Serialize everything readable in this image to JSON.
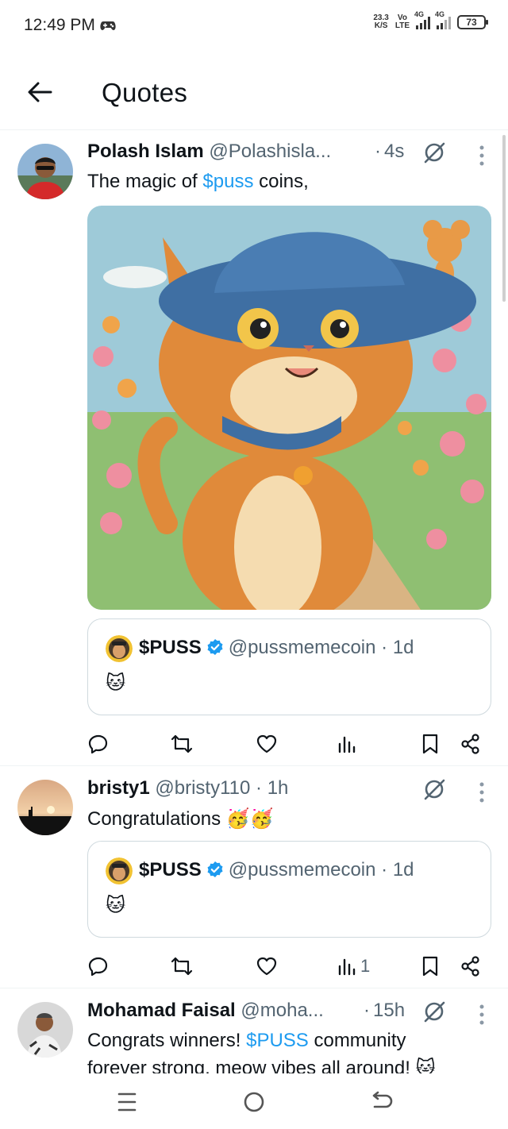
{
  "status_bar": {
    "time": "12:49 PM",
    "net_speed_value": "23.3",
    "net_speed_unit": "K/S",
    "volte_top": "Vo",
    "volte_bottom": "LTE",
    "sim1_label": "4G",
    "sim2_label": "4G",
    "battery": "73"
  },
  "header": {
    "title": "Quotes"
  },
  "posts": [
    {
      "name": "Polash Islam",
      "handle": "@Polashisla...",
      "time": "4s",
      "text_before": "The magic of ",
      "text_link": "$puss",
      "text_after": " coins,",
      "quote": {
        "name": "$PUSS",
        "handle": "@pussmemecoin",
        "time": "1d",
        "text": "🐱"
      },
      "actions": {
        "views": ""
      }
    },
    {
      "name": "bristy1",
      "handle": "@bristy110",
      "time": "1h",
      "text": "Congratulations 🥳🥳",
      "quote": {
        "name": "$PUSS",
        "handle": "@pussmemecoin",
        "time": "1d",
        "text": "🐱"
      },
      "actions": {
        "views": "1"
      }
    },
    {
      "name": "Mohamad Faisal",
      "handle": "@moha...",
      "time": "15h",
      "text_before": "Congrats winners! ",
      "text_link": "$PUSS",
      "text_after": " community",
      "text_line2": "forever strong, meow vibes all around! 🐱"
    }
  ],
  "colors": {
    "link": "#1d9bf0",
    "muted": "#536471",
    "text": "#0f1419",
    "verified": "#1d9bf0"
  },
  "icons": [
    "back-arrow-icon",
    "grok-icon",
    "more-vertical-icon",
    "reply-icon",
    "repost-icon",
    "like-icon",
    "views-icon",
    "bookmark-icon",
    "share-icon",
    "menu-icon",
    "home-icon",
    "back-icon"
  ]
}
